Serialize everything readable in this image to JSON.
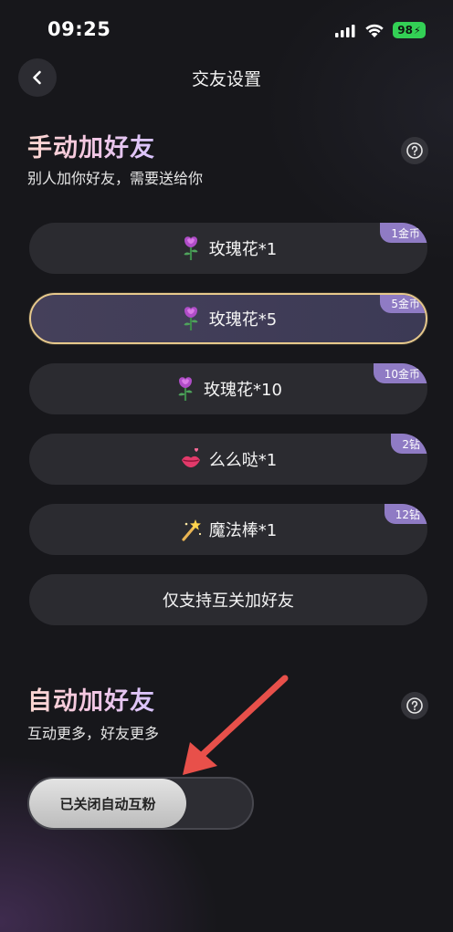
{
  "status_bar": {
    "time": "09:25",
    "battery": "98"
  },
  "header": {
    "title": "交友设置"
  },
  "manual": {
    "title": "手动加好友",
    "subtitle": "别人加你好友，需要送给你",
    "options": [
      {
        "label": "玫瑰花*1",
        "price": "1金币",
        "icon": "rose-icon",
        "selected": false
      },
      {
        "label": "玫瑰花*5",
        "price": "5金币",
        "icon": "rose-icon",
        "selected": true
      },
      {
        "label": "玫瑰花*10",
        "price": "10金币",
        "icon": "rose-icon",
        "selected": false
      },
      {
        "label": "么么哒*1",
        "price": "2钻",
        "icon": "lips-icon",
        "selected": false
      },
      {
        "label": "魔法棒*1",
        "price": "12钻",
        "icon": "magic-wand-icon",
        "selected": false
      },
      {
        "label": "仅支持互关加好友",
        "selected": false
      }
    ]
  },
  "auto": {
    "title": "自动加好友",
    "subtitle": "互动更多，好友更多",
    "toggle_label": "已关闭自动互粉",
    "toggle_on": false
  },
  "colors": {
    "accent_gold": "#e7c98c",
    "tag_purple": "#8f7bc4",
    "arrow_red": "#e8504a"
  }
}
